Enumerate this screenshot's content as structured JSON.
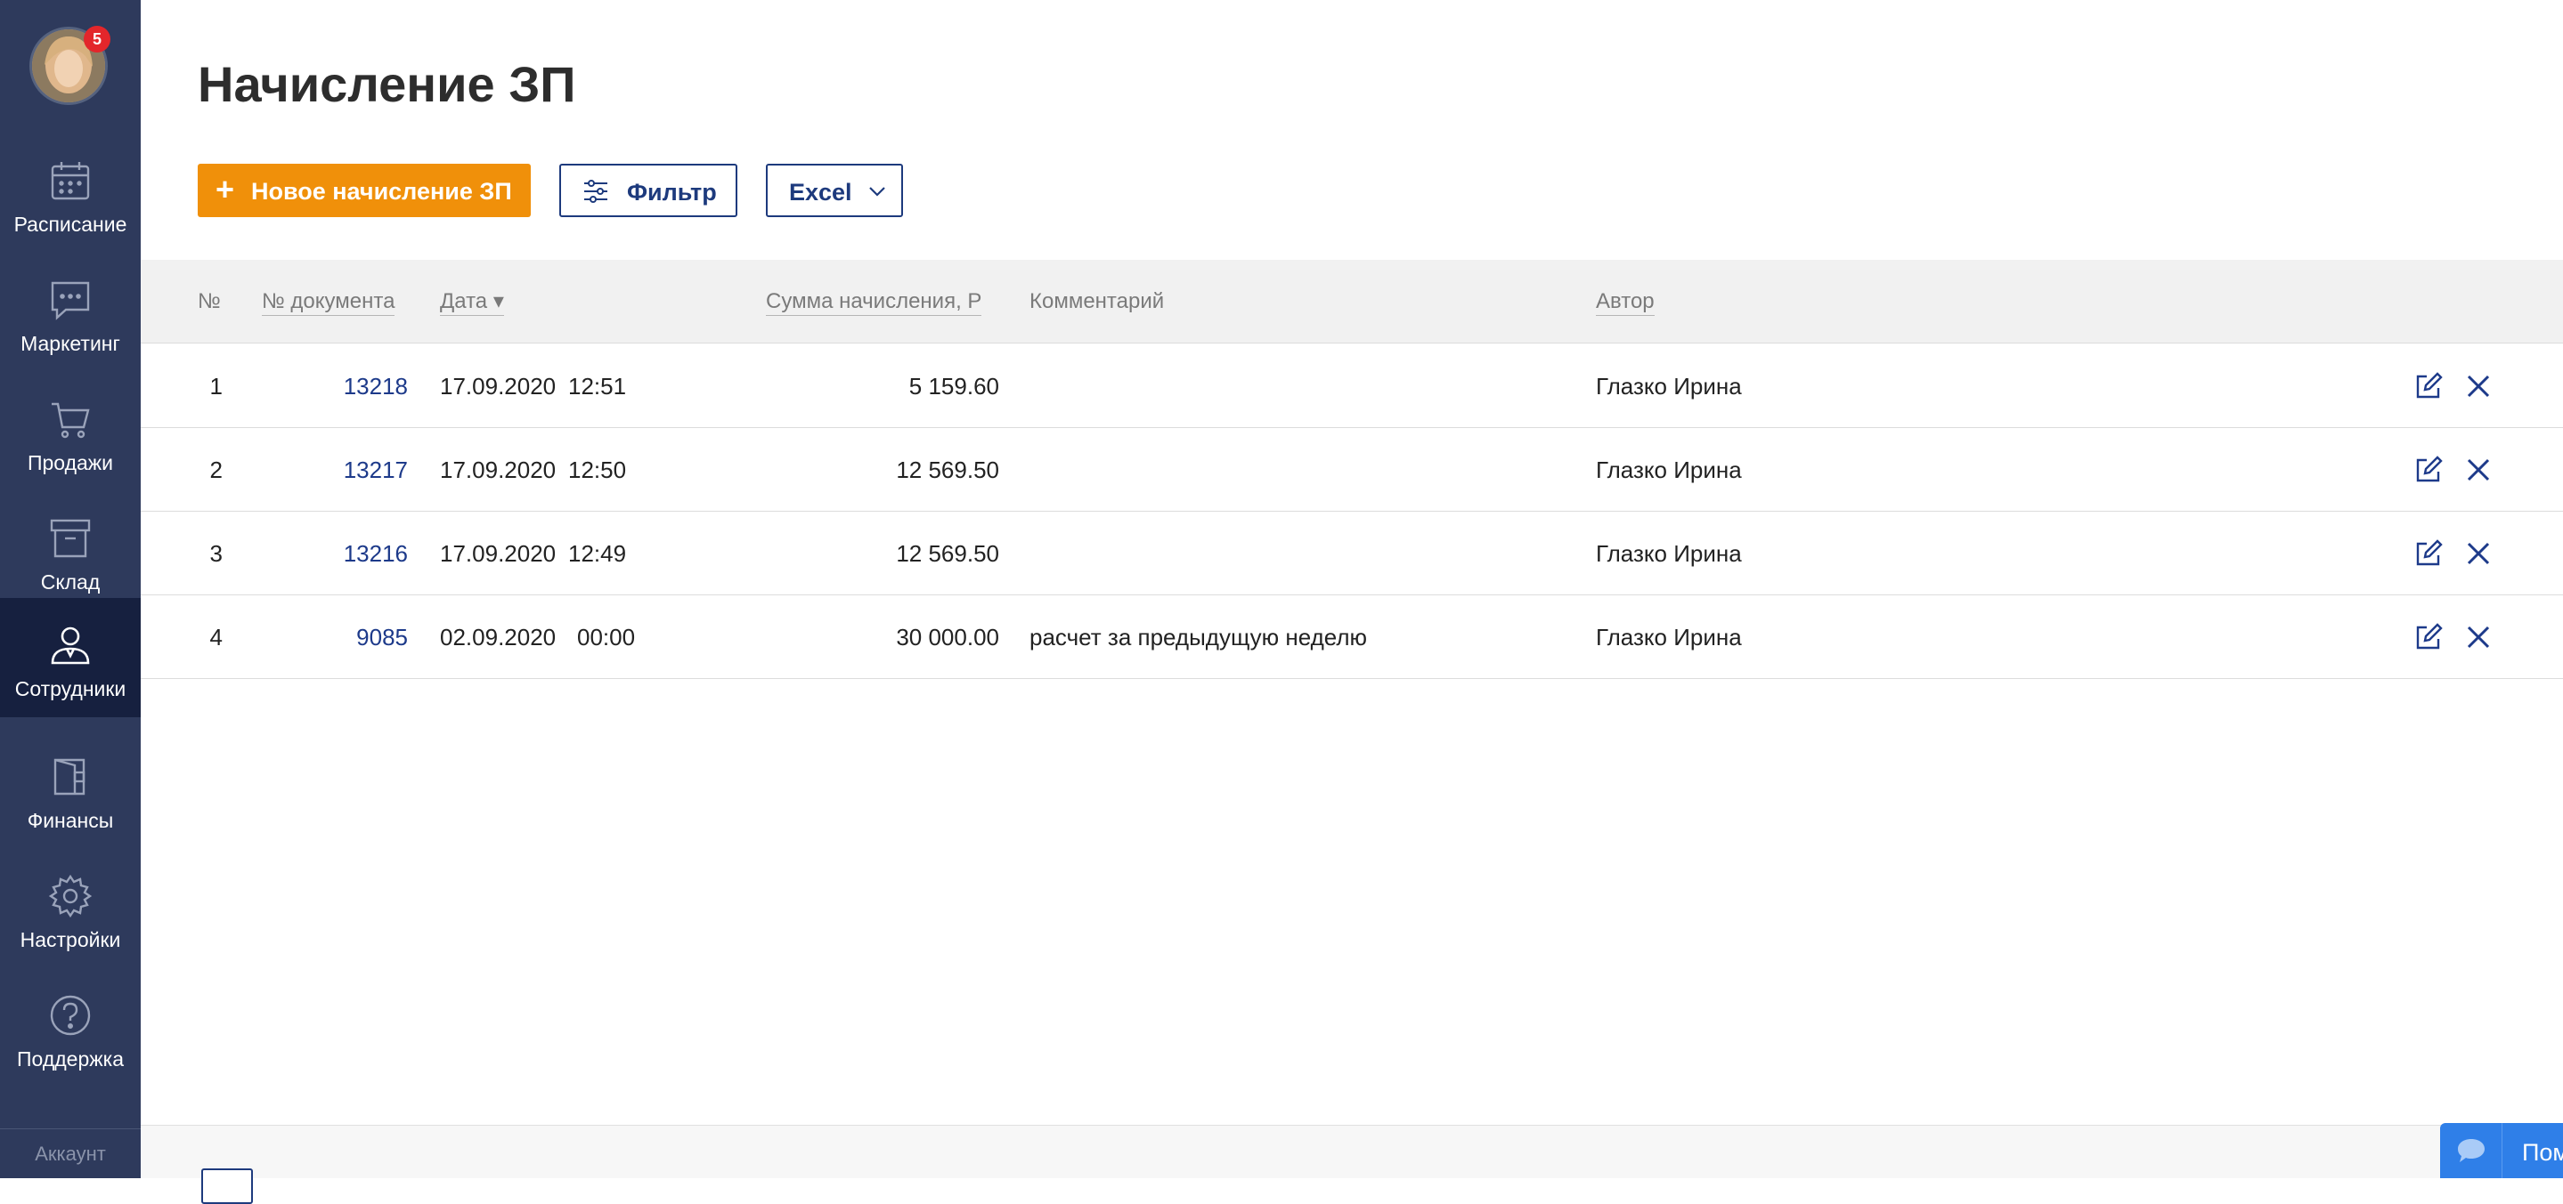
{
  "sidebar": {
    "notification_count": "5",
    "items": [
      {
        "label": "Расписание",
        "icon": "calendar-icon"
      },
      {
        "label": "Маркетинг",
        "icon": "chat-icon"
      },
      {
        "label": "Продажи",
        "icon": "cart-icon"
      },
      {
        "label": "Склад",
        "icon": "archive-box-icon"
      },
      {
        "label": "Сотрудники",
        "icon": "employee-icon",
        "active": true
      },
      {
        "label": "Финансы",
        "icon": "wallet-icon"
      },
      {
        "label": "Настройки",
        "icon": "gear-icon"
      },
      {
        "label": "Поддержка",
        "icon": "help-icon"
      }
    ],
    "account_label": "Аккаунт"
  },
  "page": {
    "title": "Начисление ЗП"
  },
  "toolbar": {
    "new_label": "Новое начисление ЗП",
    "filter_label": "Фильтр",
    "excel_label": "Excel"
  },
  "table": {
    "columns": {
      "num": "№",
      "doc": "№ документа",
      "date": "Дата ▾",
      "sum": "Сумма начисления, Р",
      "comment": "Комментарий",
      "author": "Автор"
    },
    "rows": [
      {
        "num": "1",
        "doc": "13218",
        "date": "17.09.2020",
        "time": "12:51",
        "sum": "5 159.60",
        "comment": "",
        "author": "Глазко Ирина"
      },
      {
        "num": "2",
        "doc": "13217",
        "date": "17.09.2020",
        "time": "12:50",
        "sum": "12 569.50",
        "comment": "",
        "author": "Глазко Ирина"
      },
      {
        "num": "3",
        "doc": "13216",
        "date": "17.09.2020",
        "time": "12:49",
        "sum": "12 569.50",
        "comment": "",
        "author": "Глазко Ирина"
      },
      {
        "num": "4",
        "doc": "9085",
        "date": "02.09.2020",
        "time": "00:00",
        "sum": "30 000.00",
        "comment": "расчет за предыдущую неделю",
        "author": "Глазко Ирина"
      }
    ]
  },
  "helper": {
    "label": "Помощник"
  },
  "colors": {
    "sidebar_bg": "#2e3a5c",
    "sidebar_active": "#16203f",
    "accent": "#f0900a",
    "primary_blue": "#1d3a7d",
    "helper_blue": "#2f7fe8",
    "badge_red": "#e3262b"
  }
}
